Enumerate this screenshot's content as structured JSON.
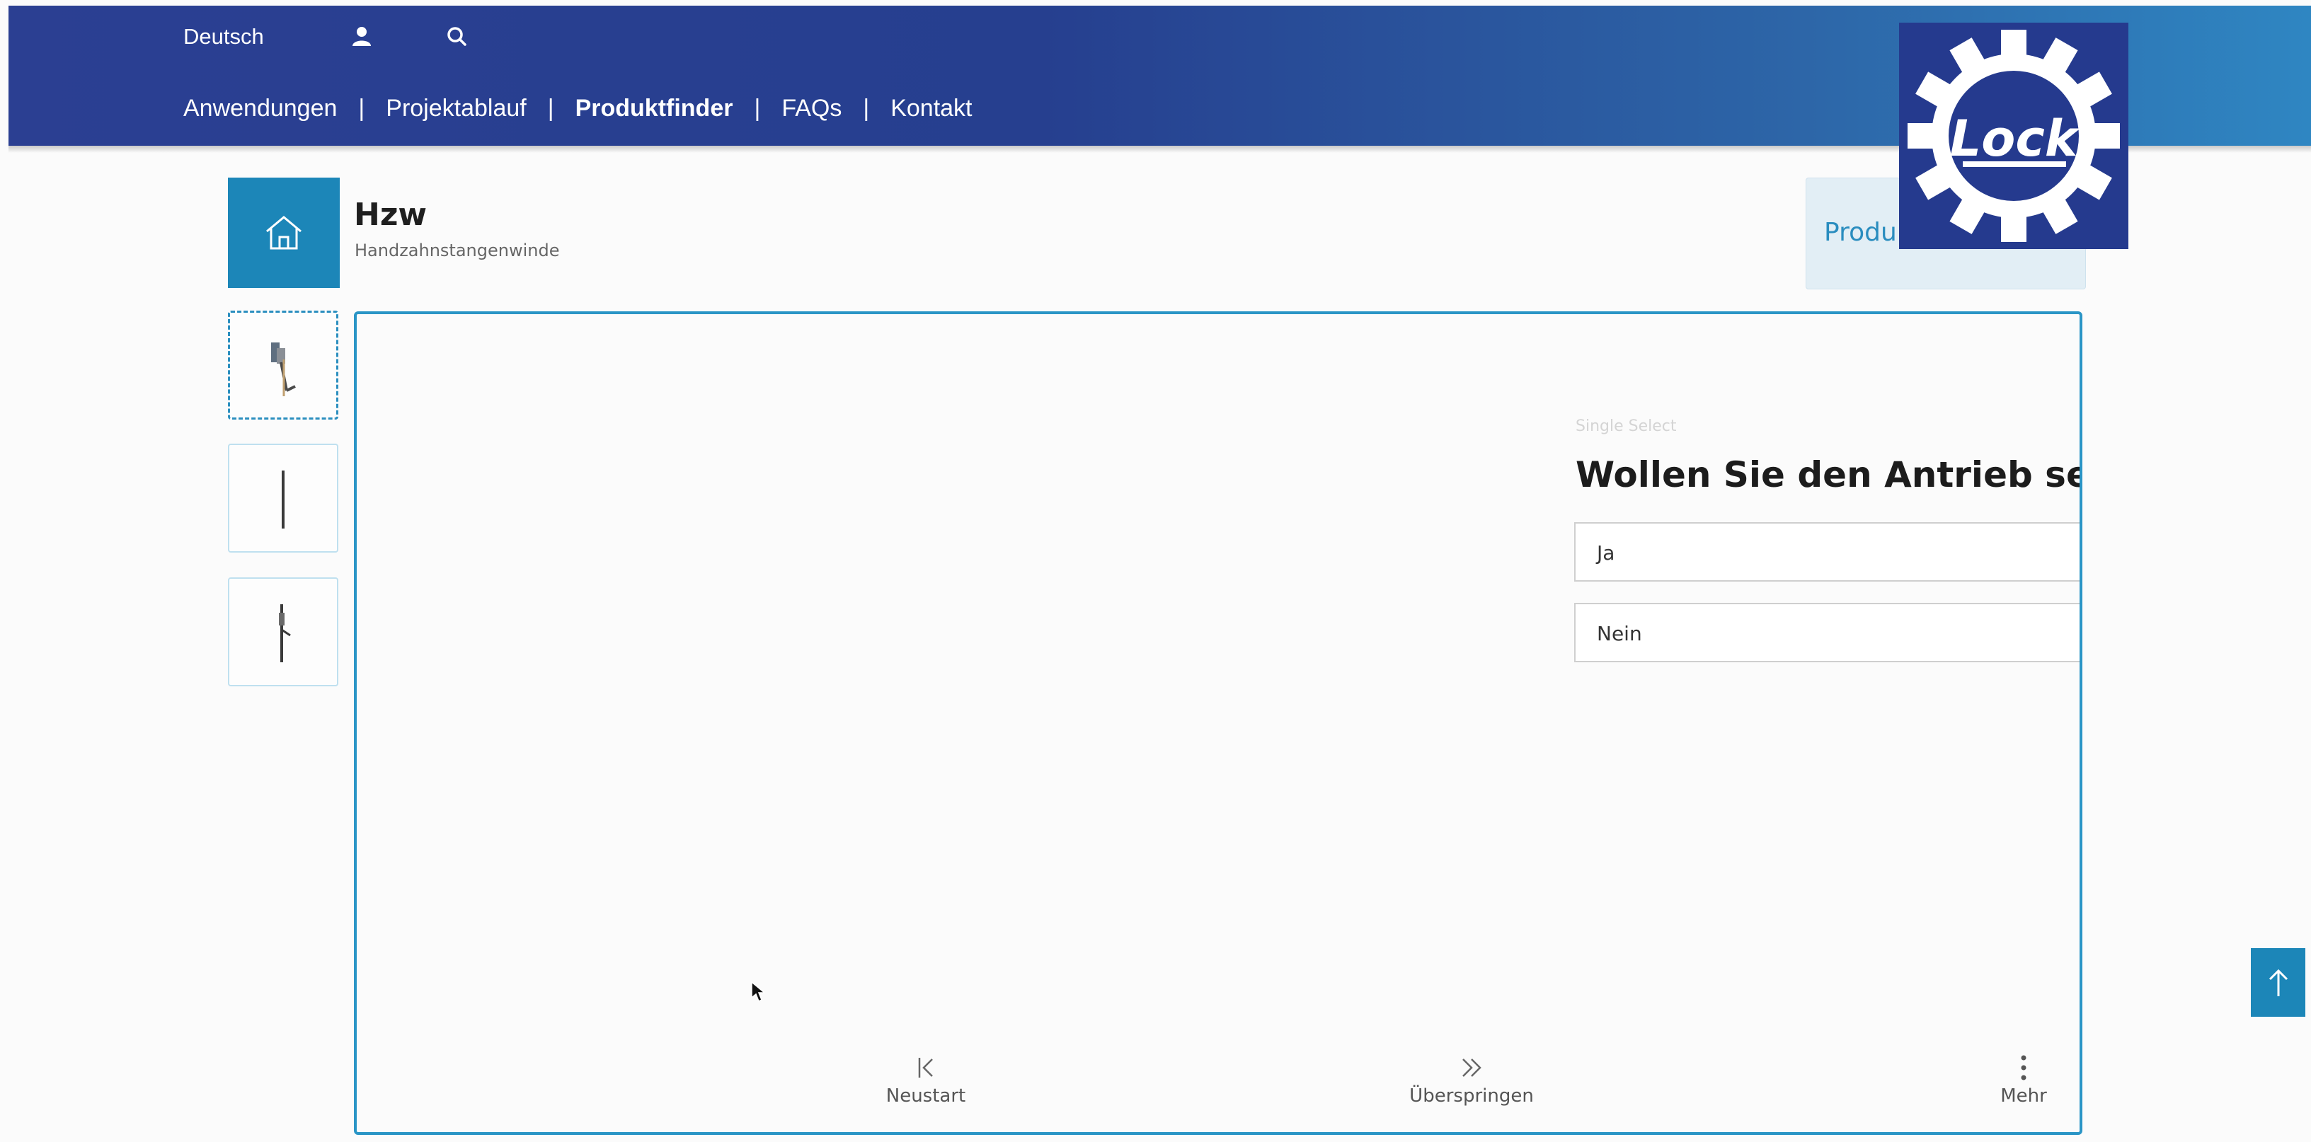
{
  "header": {
    "language": "Deutsch",
    "nav": [
      {
        "label": "Anwendungen",
        "active": false
      },
      {
        "label": "Projektablauf",
        "active": false
      },
      {
        "label": "Produktfinder",
        "active": true
      },
      {
        "label": "FAQs",
        "active": false
      },
      {
        "label": "Kontakt",
        "active": false
      }
    ],
    "separator": "|",
    "icons": [
      "user-icon",
      "search-icon"
    ]
  },
  "logo": {
    "text": "Lock"
  },
  "product": {
    "title": "Hzw",
    "subtitle": "Handzahnstangenwinde",
    "top_right_label": "Produ"
  },
  "question": {
    "type_label": "Single Select",
    "text": "Wollen Sie den Antrieb seitlich",
    "options": [
      "Ja",
      "Nein"
    ]
  },
  "footer": {
    "restart": "Neustart",
    "skip": "Überspringen",
    "more": "Mehr"
  },
  "colors": {
    "header_start": "#2b3f92",
    "header_end": "#2f86c2",
    "accent": "#1c86b8",
    "panel_border": "#2a95c6"
  }
}
